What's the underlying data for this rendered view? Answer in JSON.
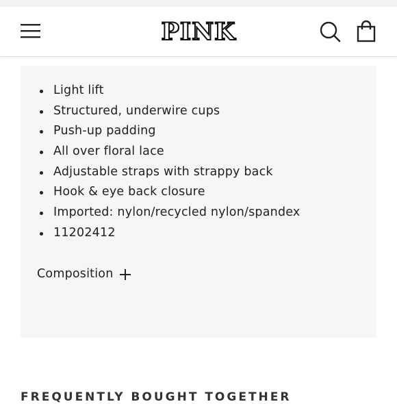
{
  "header": {
    "logo_text": "PINK",
    "menu_icon": "hamburger-menu-icon",
    "search_icon": "search-icon",
    "bag_icon": "shopping-bag-icon"
  },
  "product_details": {
    "features": [
      "Light lift",
      "Structured, underwire cups",
      "Push-up padding",
      "All over floral lace",
      "Adjustable straps with strappy back",
      "Hook & eye back closure",
      "Imported: nylon/recycled nylon/spandex",
      "11202412"
    ],
    "composition_label": "Composition",
    "composition_icon": "plus-icon"
  },
  "next_section": {
    "heading": "FREQUENTLY BOUGHT TOGETHER"
  },
  "colors": {
    "panel_background": "#f6f6f6",
    "text": "#222222",
    "header_border": "#dcdcdc"
  }
}
